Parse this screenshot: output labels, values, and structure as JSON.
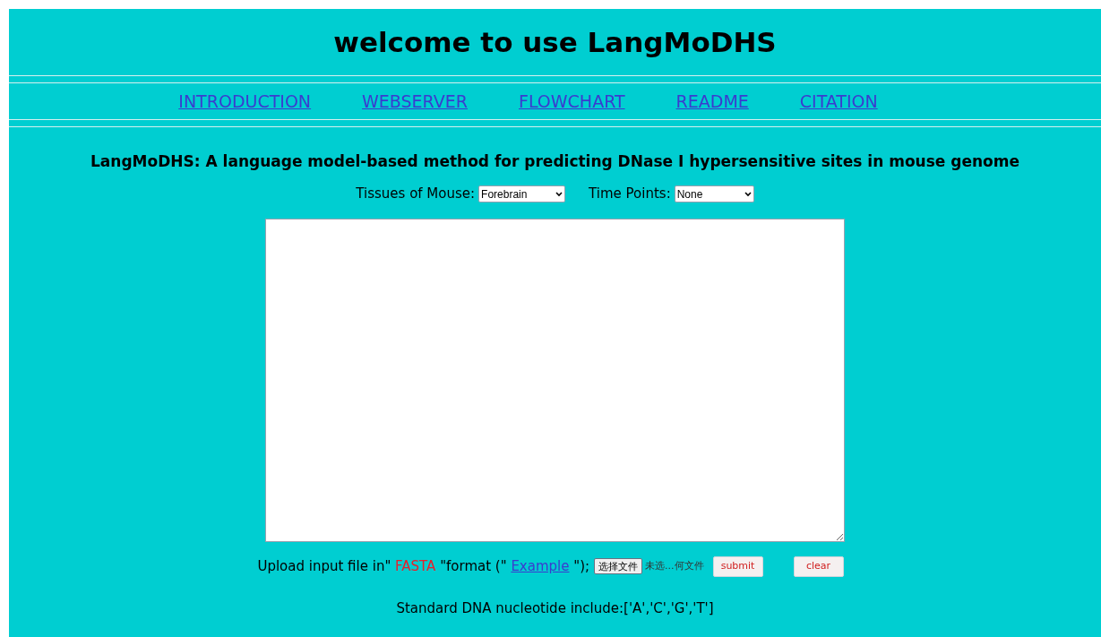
{
  "header": {
    "title": "welcome to use LangMoDHS"
  },
  "nav": [
    {
      "label": "INTRODUCTION"
    },
    {
      "label": "WEBSERVER"
    },
    {
      "label": "FLOWCHART"
    },
    {
      "label": "README"
    },
    {
      "label": "CITATION"
    }
  ],
  "subtitle": "LangMoDHS: A language model-based method for predicting DNase I hypersensitive sites in mouse genome",
  "selectors": [
    {
      "label": "Tissues of Mouse:",
      "value": "Forebrain"
    },
    {
      "label": "Time Points:",
      "value": "None"
    }
  ],
  "upload": {
    "parts": [
      {
        "kind": "text",
        "text": "Upload input file in\" "
      },
      {
        "kind": "highlight",
        "text": "FASTA"
      },
      {
        "kind": "text",
        "text": " \"format (\" "
      },
      {
        "kind": "link",
        "text": "Example"
      },
      {
        "kind": "text",
        "text": " \");"
      }
    ],
    "file_button": "选择文件",
    "file_status": "未选...何文件",
    "submit": "submit",
    "clear": "clear"
  },
  "note": "Standard DNA nucleotide include:['A','C','G','T']"
}
